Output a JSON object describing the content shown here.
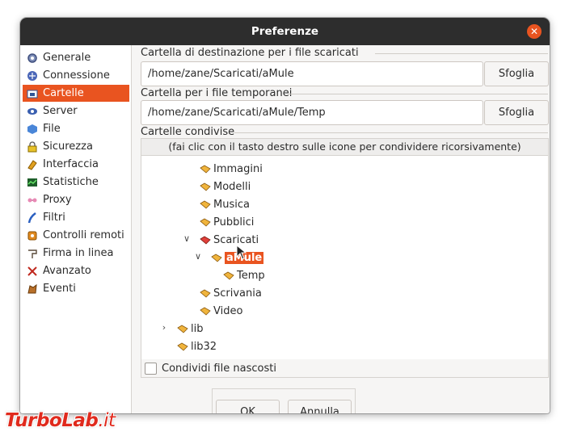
{
  "window": {
    "title": "Preferenze",
    "close_icon": "close-icon"
  },
  "sidebar": {
    "items": [
      {
        "label": "Generale",
        "icon": "gear-icon"
      },
      {
        "label": "Connessione",
        "icon": "network-icon"
      },
      {
        "label": "Cartelle",
        "icon": "folder-icon",
        "selected": true
      },
      {
        "label": "Server",
        "icon": "server-icon"
      },
      {
        "label": "File",
        "icon": "file-icon"
      },
      {
        "label": "Sicurezza",
        "icon": "lock-icon"
      },
      {
        "label": "Interfaccia",
        "icon": "interface-icon"
      },
      {
        "label": "Statistiche",
        "icon": "stats-icon"
      },
      {
        "label": "Proxy",
        "icon": "proxy-icon"
      },
      {
        "label": "Filtri",
        "icon": "filter-icon"
      },
      {
        "label": "Controlli remoti",
        "icon": "remote-icon"
      },
      {
        "label": "Firma in linea",
        "icon": "signature-icon"
      },
      {
        "label": "Avanzato",
        "icon": "advanced-icon"
      },
      {
        "label": "Eventi",
        "icon": "events-icon"
      }
    ]
  },
  "content": {
    "download_folder": {
      "label": "Cartella di destinazione per i file scaricati",
      "value": "/home/zane/Scaricati/aMule",
      "browse": "Sfoglia"
    },
    "temp_folder": {
      "label": "Cartella per i file temporanei",
      "value": "/home/zane/Scaricati/aMule/Temp",
      "browse": "Sfoglia"
    },
    "shared": {
      "label": "Cartelle condivise",
      "hint": "(fai clic con il tasto destro sulle icone per condividere ricorsivamente)",
      "tree": [
        {
          "label": "Immagini"
        },
        {
          "label": "Modelli"
        },
        {
          "label": "Musica"
        },
        {
          "label": "Pubblici"
        },
        {
          "label": "Scaricati",
          "expanded": true,
          "shared": true
        },
        {
          "label": "aMule",
          "expanded": true,
          "selected": true
        },
        {
          "label": "Temp"
        },
        {
          "label": "Scrivania"
        },
        {
          "label": "Video"
        },
        {
          "label": "lib",
          "collapsed": true
        },
        {
          "label": "lib32"
        }
      ],
      "hidden_files": {
        "label": "Condividi file nascosti",
        "checked": false
      }
    }
  },
  "buttons": {
    "ok": "OK",
    "cancel": "Annulla"
  },
  "watermark": {
    "part1": "Turbo",
    "part2": "Lab",
    "part3": ".it"
  },
  "colors": {
    "accent": "#e95420",
    "titlebar": "#2d2d2d",
    "folder": "#f0b43c",
    "shared_folder": "#e0403a"
  }
}
